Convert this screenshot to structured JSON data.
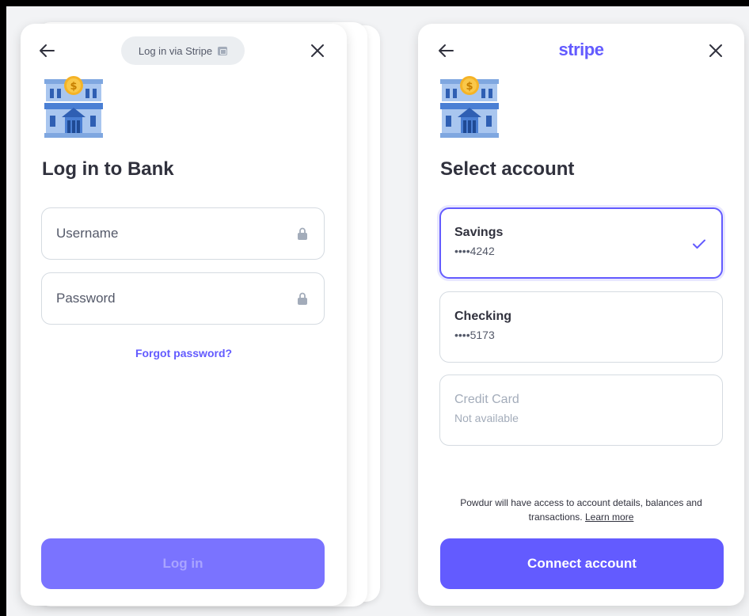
{
  "login_panel": {
    "badge_label": "Log in via Stripe",
    "title": "Log in to Bank",
    "username_placeholder": "Username",
    "password_placeholder": "Password",
    "forgot_password": "Forgot password?",
    "login_button": "Log in"
  },
  "select_panel": {
    "brand": "stripe",
    "title": "Select account",
    "accounts": [
      {
        "name": "Savings",
        "number": "••••4242",
        "selected": true,
        "available": true
      },
      {
        "name": "Checking",
        "number": "••••5173",
        "selected": false,
        "available": true
      },
      {
        "name": "Credit Card",
        "number": "Not available",
        "selected": false,
        "available": false
      }
    ],
    "disclaimer": "Powdur will have access to account details, balances and transactions.",
    "learn_more": "Learn more",
    "connect_button": "Connect account"
  },
  "icons": {
    "back": "arrow-left-icon",
    "close": "close-icon",
    "lock": "lock-icon",
    "check": "checkmark-icon",
    "bank": "bank-building-icon",
    "external": "external-link-icon"
  },
  "colors": {
    "accent": "#635bff",
    "disabled_button": "#7a73ff",
    "text": "#30313d",
    "muted": "#545969",
    "border": "#d5dbe1"
  }
}
